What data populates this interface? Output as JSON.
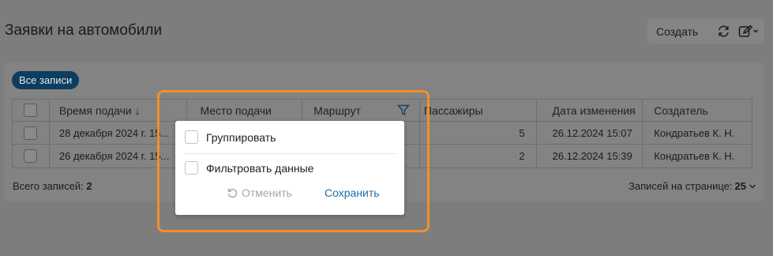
{
  "page": {
    "title": "Заявки на автомобили"
  },
  "toolbar": {
    "create_label": "Создать",
    "refresh_icon": "refresh-icon",
    "edit_icon": "edit-icon"
  },
  "filters": {
    "all_records_label": "Все записи"
  },
  "table": {
    "columns": [
      "Время подачи ↓",
      "Место подачи",
      "Маршрут",
      "Пассажиры",
      "Дата изменения",
      "Создатель"
    ],
    "rows": [
      {
        "time": "28 декабря 2024 г. 15...",
        "place": "",
        "route": "",
        "passengers": "5",
        "modified": "26.12.2024 15:07",
        "creator": "Кондратьев К. Н."
      },
      {
        "time": "26 декабря 2024 г. 15...",
        "place": "",
        "route": "",
        "passengers": "2",
        "modified": "26.12.2024 15:39",
        "creator": "Кондратьев К. Н."
      }
    ]
  },
  "footer": {
    "total_label": "Всего записей:",
    "total_value": "2",
    "per_page_label": "Записей на странице:",
    "per_page_value": "25"
  },
  "popup": {
    "group_label": "Группировать",
    "filter_label": "Фильтровать данные",
    "cancel_label": "Отменить",
    "save_label": "Сохранить"
  },
  "colors": {
    "accent": "#1f6fa8",
    "highlight": "#f0902a",
    "chip_bg": "#0d3d60"
  }
}
